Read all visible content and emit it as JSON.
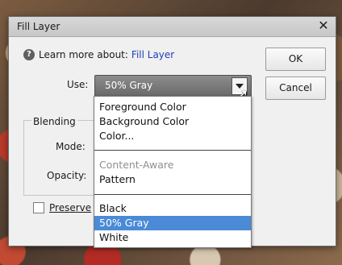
{
  "dialog": {
    "title": "Fill Layer",
    "close_glyph": "✕"
  },
  "help": {
    "prefix": "Learn more about:",
    "link": "Fill Layer",
    "icon_glyph": "?"
  },
  "buttons": {
    "ok": "OK",
    "cancel": "Cancel"
  },
  "use": {
    "label": "Use:",
    "value": "50% Gray"
  },
  "blending": {
    "legend": "Blending",
    "mode_label": "Mode:",
    "opacity_label": "Opacity:"
  },
  "preserve": {
    "label": "Preserve"
  },
  "dropdown": {
    "items": [
      {
        "label": "Foreground Color"
      },
      {
        "label": "Background Color"
      },
      {
        "label": "Color..."
      },
      {
        "label": "Content-Aware",
        "disabled": true
      },
      {
        "label": "Pattern"
      },
      {
        "label": "Black"
      },
      {
        "label": "50% Gray",
        "selected": true
      },
      {
        "label": "White"
      }
    ]
  },
  "colors": {
    "link": "#1f3fb8",
    "selection": "#4a8ad7"
  }
}
